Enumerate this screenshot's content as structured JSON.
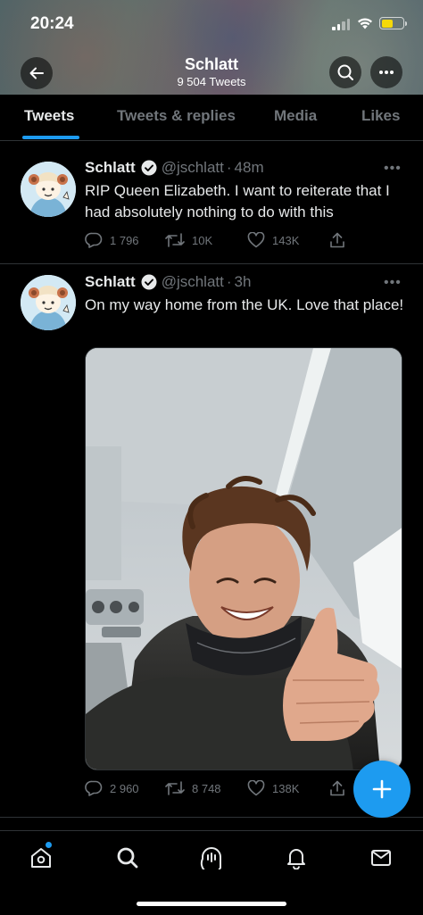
{
  "status_bar": {
    "time": "20:24"
  },
  "header": {
    "title": "Schlatt",
    "subtitle": "9 504 Tweets"
  },
  "tabs": [
    {
      "label": "Tweets",
      "active": true
    },
    {
      "label": "Tweets & replies",
      "active": false
    },
    {
      "label": "Media",
      "active": false
    },
    {
      "label": "Likes",
      "active": false
    }
  ],
  "tweets": [
    {
      "name": "Schlatt",
      "handle": "@jschlatt",
      "dot": "·",
      "time": "48m",
      "more": "•••",
      "text": "RIP Queen Elizabeth. I want to reiterate that I had absolutely nothing to do with this",
      "replies": "1 796",
      "retweets": "10K",
      "likes": "143K"
    },
    {
      "name": "Schlatt",
      "handle": "@jschlatt",
      "dot": "·",
      "time": "3h",
      "more": "•••",
      "text": "On my way home from the UK. Love that place!",
      "replies": "2 960",
      "retweets": "8 748",
      "likes": "138K"
    }
  ],
  "colors": {
    "accent": "#1d9bf0",
    "muted": "#71767b",
    "divider": "#2f3336",
    "background": "#000000"
  },
  "icons": {
    "back": "arrow-left-icon",
    "search": "search-icon",
    "more": "more-horizontal-icon",
    "reply": "reply-icon",
    "retweet": "retweet-icon",
    "like": "heart-icon",
    "share": "share-icon",
    "compose": "plus-icon",
    "nav": [
      "home-icon",
      "search-icon",
      "spaces-icon",
      "notifications-icon",
      "messages-icon"
    ]
  }
}
